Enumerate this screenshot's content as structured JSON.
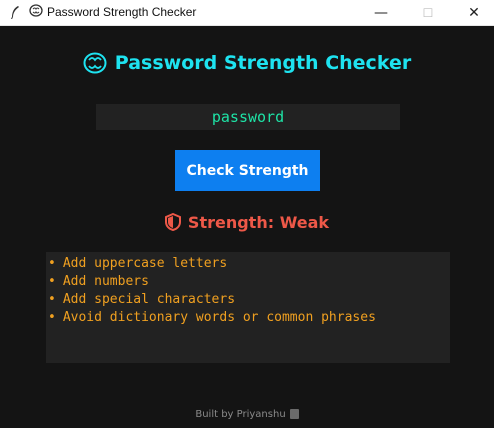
{
  "window": {
    "title": "Password Strength Checker",
    "icons": [
      "feather-icon",
      "brain-icon"
    ],
    "controls": {
      "minimize": "—",
      "maximize": "☐",
      "close": "✕"
    }
  },
  "heading": {
    "text": "Password Strength Checker",
    "icon": "brain-icon",
    "color": "#1ee3f0"
  },
  "password_input": {
    "value": "password"
  },
  "check_button": {
    "label": "Check Strength",
    "color": "#0d7ff0"
  },
  "result": {
    "text": "Strength: Weak",
    "icon": "shield-icon",
    "color": "#ee5848"
  },
  "suggestions": [
    "Add uppercase letters",
    "Add numbers",
    "Add special characters",
    "Avoid dictionary words or common phrases"
  ],
  "footer": {
    "text": "Built by Priyanshu",
    "icon": "book-icon"
  }
}
